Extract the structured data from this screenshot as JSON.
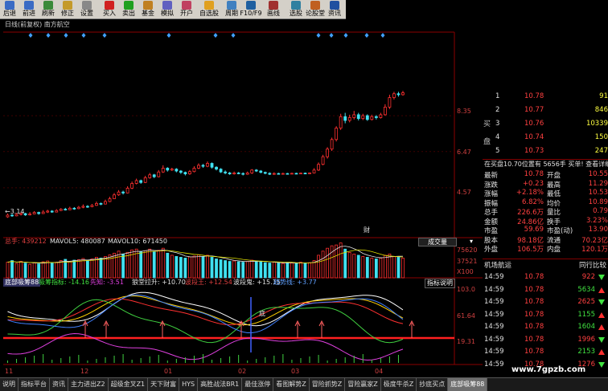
{
  "toolbar": [
    {
      "label": "后退",
      "color": "#3a6bc4"
    },
    {
      "label": "前进",
      "color": "#3a6bc4"
    },
    {
      "label": "刷新",
      "color": "#3a8a3a"
    },
    {
      "label": "修正",
      "color": "#c49a2a"
    },
    {
      "label": "设置",
      "color": "#888888"
    },
    {
      "label": "买入",
      "color": "#d02020",
      "sep": true
    },
    {
      "label": "卖出",
      "color": "#20a020"
    },
    {
      "label": "基金",
      "color": "#c08020"
    },
    {
      "label": "模拟",
      "color": "#6060c0"
    },
    {
      "label": "开户",
      "color": "#c04060"
    },
    {
      "label": "自选股",
      "color": "#e0a020",
      "sep": true
    },
    {
      "label": "周期",
      "color": "#4080c0",
      "sep": true
    },
    {
      "label": "F10/F9",
      "color": "#2060a0"
    },
    {
      "label": "画线",
      "color": "#a03030",
      "sep": true
    },
    {
      "label": "选股",
      "color": "#3080a0",
      "sep": true
    },
    {
      "label": "论股堂",
      "color": "#c06020"
    },
    {
      "label": "资讯",
      "color": "#2050a0"
    }
  ],
  "main": {
    "title": "日线(前复权)  南方航空",
    "price_labels": [
      "8.35",
      "6.47",
      "4.57"
    ],
    "low_label": "←3.14",
    "cai_label": "财",
    "x_labels": [
      "11",
      "12",
      "01",
      "02",
      "03",
      "04"
    ]
  },
  "volume": {
    "label_total": "总手: 439212",
    "mavol5": "MAVOL5: 480087",
    "mavol10": "MAVOL10: 671450",
    "button": "成交量",
    "ticks": [
      "75620",
      "37521",
      "X100"
    ]
  },
  "indicator": {
    "button": "底部吸筹88",
    "title": "吸筹指标: -14.16",
    "xianzhi": "先知: -3.51",
    "juhuang": "狼堂拉升: +10.70",
    "bohun": "波段王: +12.54",
    "boduan": "波段鬼: +15.15",
    "qushi": "趋势线: +3.77",
    "help": "指标说明",
    "ticks": [
      "103.0",
      "61.64",
      "19.31"
    ],
    "di_label": "底"
  },
  "orderbook": {
    "buy_label": "买盘",
    "rows": [
      {
        "n": "1",
        "price": "10.78",
        "vol": "91"
      },
      {
        "n": "2",
        "price": "10.77",
        "vol": "846"
      },
      {
        "n": "3",
        "price": "10.76",
        "vol": "10339"
      },
      {
        "n": "4",
        "price": "10.74",
        "vol": "150"
      },
      {
        "n": "5",
        "price": "10.73",
        "vol": "247"
      }
    ],
    "status": "在买盘10.70位置有  5656手  买单! 查看详细"
  },
  "quote": [
    {
      "l": "最新",
      "v": "10.78",
      "l2": "开盘",
      "v2": "10.55"
    },
    {
      "l": "涨跌",
      "v": "+0.23",
      "l2": "最高",
      "v2": "11.29"
    },
    {
      "l": "涨幅",
      "v": "+2.18%",
      "l2": "最低",
      "v2": "10.53"
    },
    {
      "l": "振幅",
      "v": "6.82%",
      "l2": "均价",
      "v2": "10.89"
    },
    {
      "l": "总手",
      "v": "226.6万",
      "l2": "量比",
      "v2": "0.79"
    },
    {
      "l": "金额",
      "v": "24.86亿",
      "l2": "换手",
      "v2": "3.23%"
    },
    {
      "l": "市盈",
      "v": "59.69",
      "l2": "市盈(动)",
      "v2": "13.90"
    },
    {
      "l": "股本",
      "v": "98.18亿",
      "l2": "流通",
      "v2": "70.23亿"
    },
    {
      "l": "外盘",
      "v": "106.5万",
      "l2": "内盘",
      "v2": "120.1万"
    }
  ],
  "sector": {
    "left": "机场航运",
    "right": "同行比较"
  },
  "ticks": [
    {
      "t": "14:59",
      "p": "10.78",
      "v": "922",
      "d": "dn"
    },
    {
      "t": "14:59",
      "p": "10.78",
      "v": "5634",
      "d": "up"
    },
    {
      "t": "14:59",
      "p": "10.78",
      "v": "2625",
      "d": "dn"
    },
    {
      "t": "14:59",
      "p": "10.78",
      "v": "1155",
      "d": "up"
    },
    {
      "t": "14:59",
      "p": "10.78",
      "v": "1604",
      "d": "up"
    },
    {
      "t": "14:59",
      "p": "10.78",
      "v": "1996",
      "d": "dn"
    },
    {
      "t": "14:59",
      "p": "10.78",
      "v": "2153",
      "d": "up"
    },
    {
      "t": "14:59",
      "p": "10.78",
      "v": "1276",
      "d": "dn"
    }
  ],
  "bottom_tabs": [
    "说明",
    "指标平台",
    "资讯",
    "主力进出Z2",
    "超级金叉Z1",
    "天下财富",
    "HYS",
    "高胜战法BR1",
    "最佳涨停",
    "看图解势Z",
    "冒险抓势Z",
    "冒险赢家Z",
    "极度牛杀Z",
    "抄底买点",
    "底部吸筹88"
  ],
  "watermark": "www.7gpzb.com",
  "chart_data": {
    "type": "candlestick",
    "candles": [
      [
        3.05,
        3.14,
        3.22,
        3.0
      ],
      [
        3.14,
        3.1,
        3.2,
        3.05
      ],
      [
        3.1,
        3.18,
        3.25,
        3.08
      ],
      [
        3.18,
        3.22,
        3.28,
        3.12
      ],
      [
        3.22,
        3.15,
        3.26,
        3.1
      ],
      [
        3.15,
        3.2,
        3.3,
        3.12
      ],
      [
        3.2,
        3.28,
        3.35,
        3.18
      ],
      [
        3.28,
        3.22,
        3.32,
        3.16
      ],
      [
        3.22,
        3.3,
        3.4,
        3.2
      ],
      [
        3.3,
        3.35,
        3.42,
        3.25
      ],
      [
        3.35,
        3.3,
        3.4,
        3.26
      ],
      [
        3.3,
        3.38,
        3.45,
        3.28
      ],
      [
        3.38,
        3.45,
        3.5,
        3.35
      ],
      [
        3.45,
        3.42,
        3.52,
        3.38
      ],
      [
        3.42,
        3.5,
        3.58,
        3.4
      ],
      [
        3.5,
        3.48,
        3.56,
        3.42
      ],
      [
        3.48,
        3.55,
        3.62,
        3.45
      ],
      [
        3.55,
        3.6,
        3.7,
        3.5
      ],
      [
        3.6,
        3.58,
        3.66,
        3.52
      ],
      [
        3.58,
        3.65,
        3.72,
        3.55
      ],
      [
        3.65,
        3.75,
        3.85,
        3.62
      ],
      [
        3.75,
        3.72,
        3.8,
        3.66
      ],
      [
        3.72,
        3.85,
        3.95,
        3.7
      ],
      [
        3.85,
        4.0,
        4.1,
        3.82
      ],
      [
        4.0,
        4.2,
        4.3,
        3.98
      ],
      [
        4.2,
        4.35,
        4.45,
        4.15
      ],
      [
        4.35,
        4.3,
        4.42,
        4.22
      ],
      [
        4.3,
        4.55,
        4.65,
        4.28
      ],
      [
        4.55,
        4.8,
        4.9,
        4.5
      ],
      [
        4.8,
        4.95,
        5.05,
        4.75
      ],
      [
        4.95,
        4.85,
        5.0,
        4.78
      ],
      [
        4.85,
        5.1,
        5.2,
        4.82
      ],
      [
        5.1,
        5.25,
        5.35,
        5.05
      ],
      [
        5.25,
        5.15,
        5.3,
        5.08
      ],
      [
        5.15,
        5.4,
        5.5,
        5.12
      ],
      [
        5.4,
        5.6,
        5.75,
        5.35
      ],
      [
        5.6,
        5.5,
        5.65,
        5.42
      ],
      [
        5.5,
        5.55,
        5.62,
        5.45
      ],
      [
        5.55,
        5.45,
        5.6,
        5.38
      ],
      [
        5.45,
        5.38,
        5.5,
        5.3
      ],
      [
        5.38,
        5.3,
        5.42,
        5.22
      ],
      [
        5.3,
        5.42,
        5.5,
        5.25
      ],
      [
        5.42,
        5.6,
        5.7,
        5.38
      ],
      [
        5.6,
        5.75,
        5.85,
        5.55
      ],
      [
        5.75,
        5.7,
        5.82,
        5.62
      ],
      [
        5.7,
        5.85,
        5.95,
        5.65
      ],
      [
        5.85,
        5.65,
        5.9,
        5.58
      ],
      [
        5.65,
        5.55,
        5.7,
        5.48
      ],
      [
        5.55,
        5.4,
        5.6,
        5.35
      ],
      [
        5.4,
        5.35,
        5.48,
        5.28
      ],
      [
        5.35,
        5.3,
        5.4,
        5.25
      ],
      [
        5.3,
        5.35,
        5.42,
        5.26
      ],
      [
        5.35,
        5.32,
        5.4,
        5.28
      ],
      [
        5.32,
        5.28,
        5.38,
        5.22
      ],
      [
        5.28,
        5.35,
        5.42,
        5.25
      ],
      [
        5.35,
        5.5,
        5.55,
        5.3
      ],
      [
        5.5,
        5.45,
        5.55,
        5.4
      ],
      [
        5.45,
        5.38,
        5.5,
        5.33
      ],
      [
        5.38,
        5.33,
        5.42,
        5.28
      ],
      [
        5.33,
        5.28,
        5.38,
        5.24
      ],
      [
        5.28,
        5.32,
        5.38,
        5.25
      ],
      [
        5.32,
        5.3,
        5.36,
        5.26
      ],
      [
        5.3,
        5.32,
        5.36,
        5.27
      ],
      [
        5.32,
        5.3,
        5.35,
        5.26
      ],
      [
        5.3,
        5.33,
        5.36,
        5.28
      ],
      [
        5.33,
        5.31,
        5.36,
        5.28
      ],
      [
        5.31,
        5.34,
        5.37,
        5.29
      ],
      [
        5.34,
        5.32,
        5.37,
        5.3
      ],
      [
        5.32,
        5.35,
        5.38,
        5.3
      ],
      [
        5.35,
        5.5,
        5.6,
        5.33
      ],
      [
        5.5,
        5.8,
        5.9,
        5.45
      ],
      [
        5.8,
        6.2,
        6.3,
        5.75
      ],
      [
        6.2,
        6.6,
        6.7,
        6.1
      ],
      [
        6.6,
        7.1,
        7.2,
        6.5
      ],
      [
        7.1,
        7.7,
        7.8,
        7.0
      ],
      [
        7.7,
        8.3,
        8.45,
        7.6
      ],
      [
        8.3,
        8.1,
        8.5,
        7.95
      ],
      [
        8.1,
        8.25,
        8.4,
        8.0
      ],
      [
        8.25,
        8.4,
        8.6,
        8.15
      ],
      [
        8.4,
        8.2,
        8.5,
        8.1
      ],
      [
        8.2,
        8.35,
        8.45,
        8.12
      ],
      [
        8.35,
        8.15,
        8.42,
        8.08
      ],
      [
        8.15,
        8.3,
        8.4,
        8.1
      ],
      [
        8.3,
        8.25,
        8.38,
        8.15
      ],
      [
        8.25,
        8.4,
        8.5,
        8.2
      ],
      [
        8.4,
        8.8,
        8.95,
        8.35
      ],
      [
        8.8,
        9.3,
        9.45,
        8.7
      ],
      [
        9.3,
        9.5,
        9.6,
        9.2
      ],
      [
        9.5,
        9.45,
        9.6,
        9.35
      ],
      [
        9.45,
        9.55,
        9.65,
        9.4
      ]
    ],
    "volume": [
      38000,
      42000,
      35000,
      40000,
      36000,
      33000,
      37000,
      34000,
      39000,
      41000,
      36000,
      38000,
      42000,
      45000,
      40000,
      43000,
      44000,
      47000,
      42000,
      46000,
      50000,
      48000,
      52000,
      56000,
      60000,
      65000,
      58000,
      62000,
      68000,
      70000,
      64000,
      66000,
      70000,
      63000,
      67000,
      72000,
      60000,
      55000,
      52000,
      50000,
      48000,
      51000,
      53000,
      56000,
      52000,
      55000,
      50000,
      46000,
      44000,
      42000,
      40000,
      41000,
      39000,
      38000,
      40000,
      43000,
      41000,
      39000,
      37000,
      36000,
      38000,
      36000,
      35000,
      37000,
      36000,
      35000,
      38000,
      36000,
      37000,
      42000,
      55000,
      65000,
      72000,
      78000,
      80000,
      85000,
      70000,
      62000,
      58000,
      55000,
      52000,
      50000,
      48000,
      46000,
      48000,
      55000,
      58000,
      52000,
      50000,
      48000
    ]
  }
}
